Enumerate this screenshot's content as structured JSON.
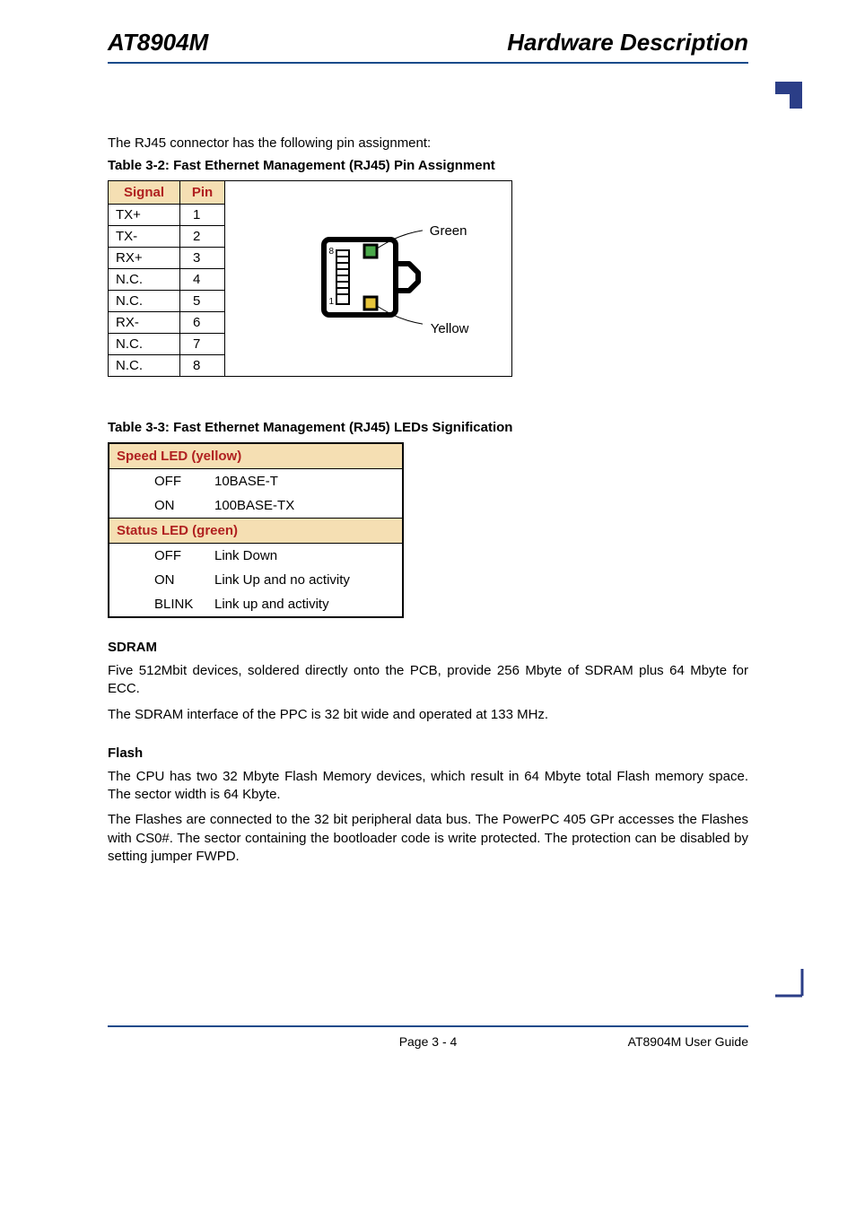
{
  "header": {
    "left": "AT8904M",
    "right": "Hardware Description"
  },
  "intro": "The RJ45 connector has the following pin assignment:",
  "table32": {
    "caption": "Table 3-2:   Fast Ethernet Management (RJ45) Pin Assignment",
    "headers": {
      "signal": "Signal",
      "pin": "Pin"
    },
    "rows": [
      {
        "signal": "TX+",
        "pin": "1"
      },
      {
        "signal": "TX-",
        "pin": "2"
      },
      {
        "signal": "RX+",
        "pin": "3"
      },
      {
        "signal": "N.C.",
        "pin": "4"
      },
      {
        "signal": "N.C.",
        "pin": "5"
      },
      {
        "signal": "RX-",
        "pin": "6"
      },
      {
        "signal": "N.C.",
        "pin": "7"
      },
      {
        "signal": "N.C.",
        "pin": "8"
      }
    ],
    "diagram": {
      "pin_top": "8",
      "pin_bottom": "1",
      "label_green": "Green",
      "label_yellow": "Yellow"
    }
  },
  "table33": {
    "caption": "Table 3-3:   Fast Ethernet Management (RJ45) LEDs Signification",
    "section1": "Speed LED (yellow)",
    "rows1": [
      {
        "state": "OFF",
        "meaning": "10BASE-T"
      },
      {
        "state": "ON",
        "meaning": "100BASE-TX"
      }
    ],
    "section2": "Status LED (green)",
    "rows2": [
      {
        "state": "OFF",
        "meaning": "Link Down"
      },
      {
        "state": "ON",
        "meaning": "Link Up and no activity"
      },
      {
        "state": "BLINK",
        "meaning": "Link up and activity"
      }
    ]
  },
  "sdram": {
    "heading": "SDRAM",
    "p1": "Five 512Mbit devices, soldered directly onto the PCB, provide 256 Mbyte of SDRAM plus 64 Mbyte for ECC.",
    "p2": "The SDRAM interface of the PPC is 32 bit wide and operated at 133 MHz."
  },
  "flash": {
    "heading": "Flash",
    "p1": "The CPU has two 32 Mbyte Flash Memory devices, which result in 64 Mbyte total Flash memory space. The sector width is 64 Kbyte.",
    "p2": "The Flashes are connected to the 32 bit peripheral data bus. The PowerPC 405 GPr accesses the Flashes with CS0#. The sector containing the bootloader code is write protected. The protection can be disabled by setting jumper FWPD."
  },
  "footer": {
    "page": "Page 3 - 4",
    "guide": "AT8904M User Guide"
  }
}
